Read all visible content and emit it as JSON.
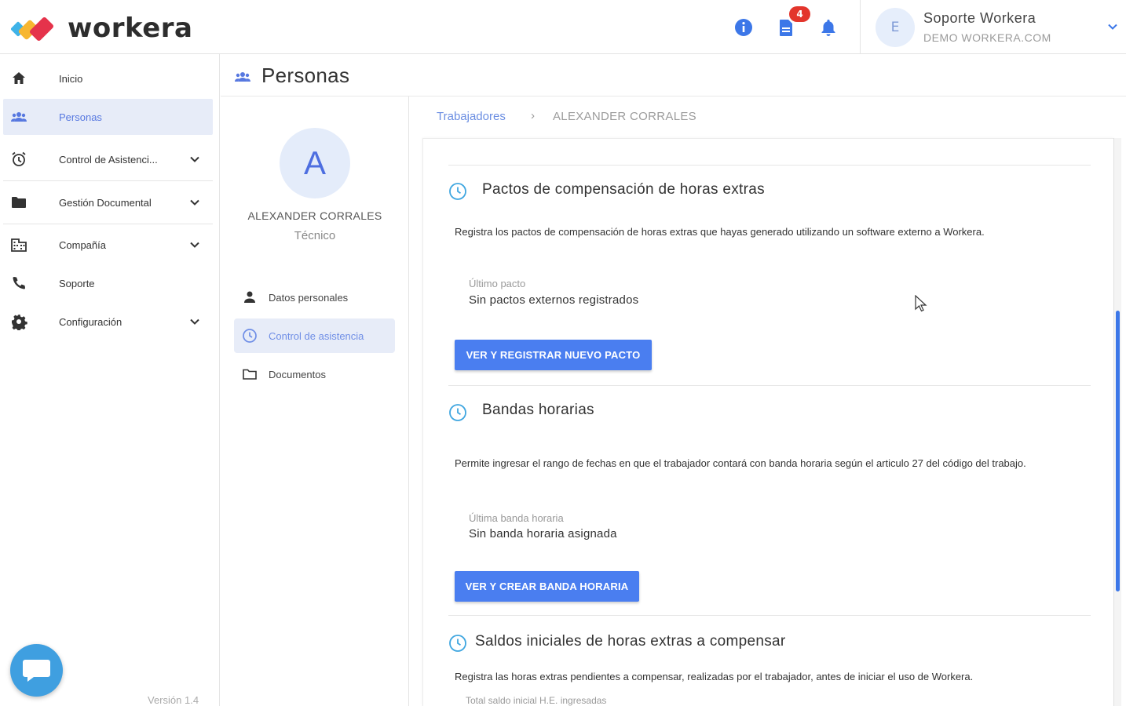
{
  "app": {
    "logo_text": "workera"
  },
  "header": {
    "notifications_badge": "4",
    "user_initial": "E",
    "user_name": "Soporte Workera",
    "user_domain": "DEMO WORKERA.COM"
  },
  "sidebar": {
    "items": [
      {
        "label": "Inicio",
        "icon": "home-icon"
      },
      {
        "label": "Personas",
        "icon": "people-icon",
        "active": true
      },
      {
        "label": "Control de Asistenci...",
        "icon": "alarm-clock-icon",
        "expandable": true
      },
      {
        "label": "Gestión Documental",
        "icon": "folder-icon",
        "expandable": true
      },
      {
        "label": "Compañía",
        "icon": "building-icon",
        "expandable": true
      },
      {
        "label": "Soporte",
        "icon": "phone-icon"
      },
      {
        "label": "Configuración",
        "icon": "gear-icon",
        "expandable": true
      }
    ],
    "version": "Versión 1.4"
  },
  "page": {
    "title": "Personas"
  },
  "profile": {
    "initial": "A",
    "name": "ALEXANDER CORRALES",
    "role": "Técnico",
    "nav": [
      {
        "label": "Datos personales",
        "icon": "person-icon"
      },
      {
        "label": "Control de asistencia",
        "icon": "clock-icon",
        "active": true
      },
      {
        "label": "Documentos",
        "icon": "folder-outline-icon"
      }
    ]
  },
  "breadcrumb": {
    "parent": "Trabajadores",
    "separator": "›",
    "current": "ALEXANDER CORRALES"
  },
  "sections": [
    {
      "title": "Pactos de compensación de horas extras",
      "description": "Registra los pactos de compensación de horas extras que hayas generado utilizando un software externo a Workera.",
      "field_label": "Último pacto",
      "field_value": "Sin pactos externos registrados",
      "button": "VER Y REGISTRAR NUEVO PACTO"
    },
    {
      "title": "Bandas horarias",
      "description": "Permite ingresar el rango de fechas en que el trabajador contará con banda horaria según el articulo 27 del código del trabajo.",
      "field_label": "Última banda horaria",
      "field_value": "Sin banda horaria asignada",
      "button": "VER Y CREAR BANDA HORARIA"
    },
    {
      "title": "Saldos iniciales de horas extras a compensar",
      "description": "Registra las horas extras pendientes a compensar, realizadas por el trabajador, antes de iniciar el uso de Workera.",
      "field_label": "Total saldo inicial H.E. ingresadas"
    }
  ],
  "colors": {
    "primary": "#4a7ef0",
    "accent_blue": "#3c77e8",
    "active_bg": "#e7ecf8",
    "badge_red": "#e3352c"
  }
}
